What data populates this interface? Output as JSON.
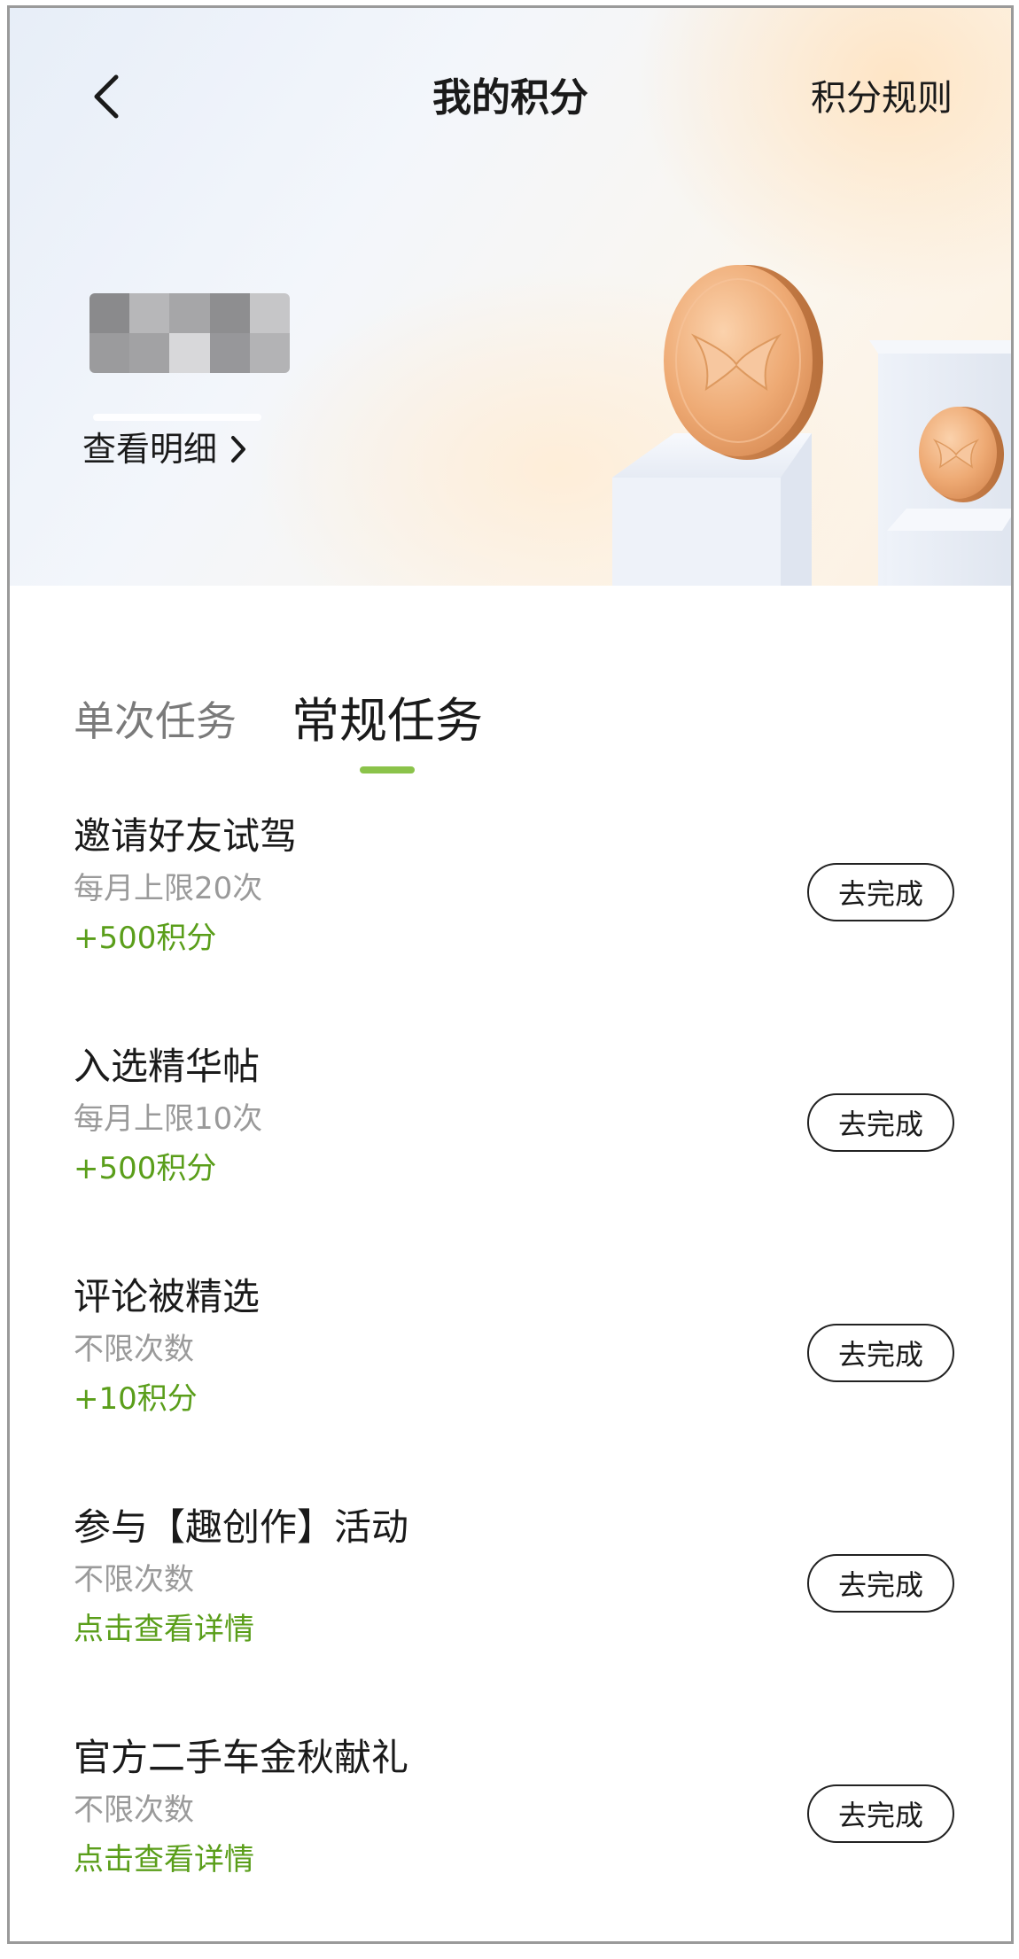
{
  "header": {
    "title": "我的积分",
    "rules_label": "积分规则",
    "back_icon": "chevron-left-icon"
  },
  "summary": {
    "view_detail_label": "查看明细",
    "detail_icon": "chevron-right-icon"
  },
  "tabs": [
    {
      "label": "单次任务",
      "active": false
    },
    {
      "label": "常规任务",
      "active": true
    }
  ],
  "accent_color": "#8bc34a",
  "reward_color": "#5a9e1a",
  "tasks": [
    {
      "title": "邀请好友试驾",
      "limit": "每月上限20次",
      "reward": "+500积分",
      "button": "去完成"
    },
    {
      "title": "入选精华帖",
      "limit": "每月上限10次",
      "reward": "+500积分",
      "button": "去完成"
    },
    {
      "title": "评论被精选",
      "limit": "不限次数",
      "reward": "+10积分",
      "button": "去完成"
    },
    {
      "title": "参与【趣创作】活动",
      "limit": "不限次数",
      "reward": "点击查看详情",
      "button": "去完成"
    },
    {
      "title": "官方二手车金秋献礼",
      "limit": "不限次数",
      "reward": "点击查看详情",
      "button": "去完成"
    }
  ]
}
